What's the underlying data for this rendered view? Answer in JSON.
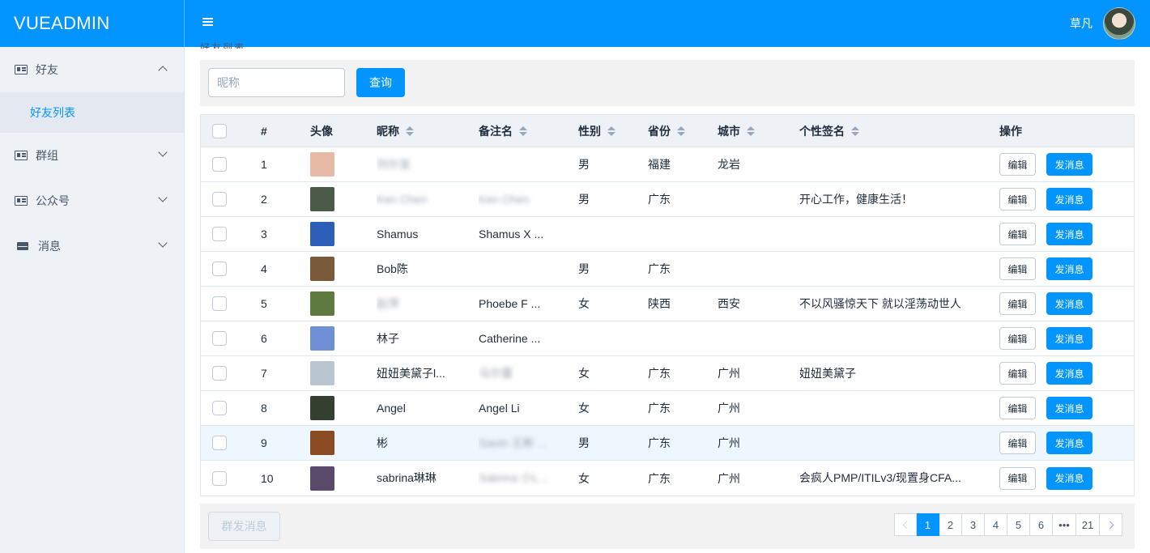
{
  "app": {
    "title": "VUEADMIN"
  },
  "header": {
    "user_name": "草凡"
  },
  "breadcrumb": {
    "peek_text": "好友列表"
  },
  "sidebar": {
    "items": [
      {
        "label": "好友",
        "icon": "id-card-icon",
        "expanded": true,
        "children": [
          {
            "label": "好友列表",
            "active": true
          }
        ]
      },
      {
        "label": "群组",
        "icon": "id-card-icon",
        "expanded": false
      },
      {
        "label": "公众号",
        "icon": "id-card-icon",
        "expanded": false
      },
      {
        "label": "消息",
        "icon": "mail-icon",
        "expanded": false
      }
    ]
  },
  "search": {
    "placeholder": "昵称",
    "value": "",
    "button_label": "查询"
  },
  "table": {
    "columns": {
      "index": "#",
      "avatar": "头像",
      "nickname": "昵称",
      "remark": "备注名",
      "gender": "性别",
      "province": "省份",
      "city": "城市",
      "signature": "个性签名",
      "actions": "操作"
    },
    "edit_label": "编辑",
    "send_label": "发消息",
    "rows": [
      {
        "index": "1",
        "nickname": "刘尔发",
        "nickname_blurred": true,
        "remark": "",
        "remark_blurred": false,
        "gender": "男",
        "province": "福建",
        "city": "龙岩",
        "signature": "",
        "avatar_color": "#e8b9a4"
      },
      {
        "index": "2",
        "nickname": "Ken Chen",
        "nickname_blurred": true,
        "remark": "Ken Chen",
        "remark_blurred": true,
        "gender": "男",
        "province": "广东",
        "city": "",
        "signature": "开心工作，健康生活！",
        "avatar_color": "#4c5a4a"
      },
      {
        "index": "3",
        "nickname": "Shamus",
        "nickname_blurred": false,
        "remark": "Shamus X ...",
        "remark_blurred": false,
        "gender": "",
        "province": "",
        "city": "",
        "signature": "",
        "avatar_color": "#2d5fb8"
      },
      {
        "index": "4",
        "nickname": "Bob陈",
        "nickname_blurred": false,
        "remark": "",
        "remark_blurred": false,
        "gender": "男",
        "province": "广东",
        "city": "",
        "signature": "",
        "avatar_color": "#7a5a3a"
      },
      {
        "index": "5",
        "nickname": "赵萍",
        "nickname_blurred": true,
        "remark": "Phoebe F ...",
        "remark_blurred": false,
        "gender": "女",
        "province": "陕西",
        "city": "西安",
        "signature": "不以风骚惊天下 就以淫荡动世人",
        "avatar_color": "#5e7a3e"
      },
      {
        "index": "6",
        "nickname": "林子",
        "nickname_blurred": false,
        "remark": "Catherine ...",
        "remark_blurred": false,
        "gender": "",
        "province": "",
        "city": "",
        "signature": "",
        "avatar_color": "#6f8fd6"
      },
      {
        "index": "7",
        "nickname": "妞妞美黛子l...",
        "nickname_blurred": false,
        "remark": "马尔蕾",
        "remark_blurred": true,
        "gender": "女",
        "province": "广东",
        "city": "广州",
        "signature": "妞妞美黛子",
        "avatar_color": "#b9c6d0"
      },
      {
        "index": "8",
        "nickname": "Angel",
        "nickname_blurred": false,
        "remark": "Angel Li",
        "remark_blurred": false,
        "gender": "女",
        "province": "广东",
        "city": "广州",
        "signature": "",
        "avatar_color": "#33402f"
      },
      {
        "index": "9",
        "nickname": "彬",
        "nickname_blurred": false,
        "remark": "Gavin 王彬 ...",
        "remark_blurred": true,
        "gender": "男",
        "province": "广东",
        "city": "广州",
        "signature": "",
        "avatar_color": "#8a4a22",
        "hover": true
      },
      {
        "index": "10",
        "nickname": "sabrina琳琳",
        "nickname_blurred": false,
        "remark": "Sabrina 小L...",
        "remark_blurred": true,
        "gender": "女",
        "province": "广东",
        "city": "广州",
        "signature": "会疯人PMP/ITILv3/现置身CFA...",
        "avatar_color": "#5a4a6a"
      }
    ]
  },
  "footer": {
    "bulk_button_label": "群发消息",
    "pagination": {
      "pages": [
        "1",
        "2",
        "3",
        "4",
        "5",
        "6",
        "•••",
        "21"
      ],
      "current": "1"
    }
  },
  "colors": {
    "primary": "#0294ff",
    "sidebar_bg": "#eef1f6",
    "text": "#1f2d3d"
  }
}
